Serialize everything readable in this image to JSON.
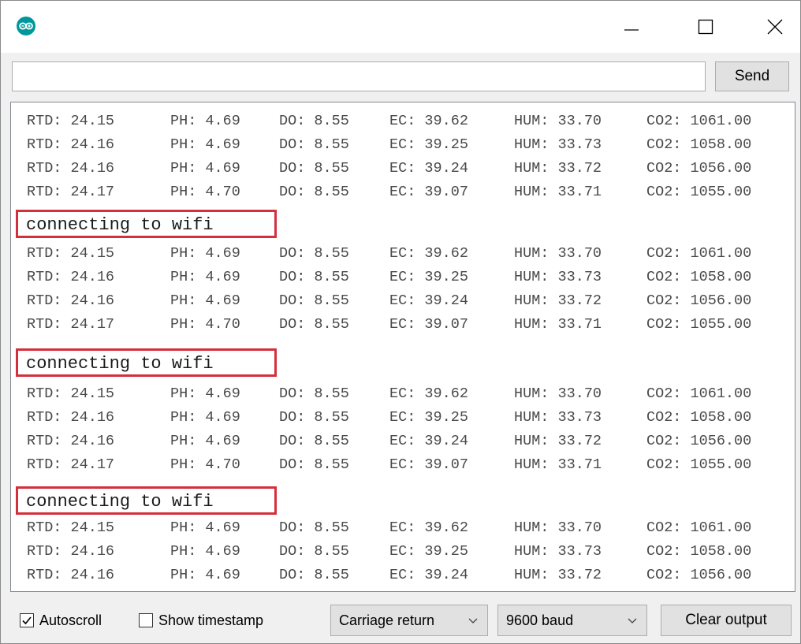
{
  "window": {
    "icon": "arduino-logo-icon",
    "accent_color": "#00979c",
    "highlight_color": "#d32f3c"
  },
  "toolbar": {
    "input_value": "",
    "send_label": "Send"
  },
  "output": {
    "readings": [
      [
        "RTD: 24.15",
        "PH: 4.69",
        "DO: 8.55",
        "EC: 39.62",
        "HUM: 33.70",
        "CO2: 1061.00"
      ],
      [
        "RTD: 24.16",
        "PH: 4.69",
        "DO: 8.55",
        "EC: 39.25",
        "HUM: 33.73",
        "CO2: 1058.00"
      ],
      [
        "RTD: 24.16",
        "PH: 4.69",
        "DO: 8.55",
        "EC: 39.24",
        "HUM: 33.72",
        "CO2: 1056.00"
      ],
      [
        "RTD: 24.17",
        "PH: 4.70",
        "DO: 8.55",
        "EC: 39.07",
        "HUM: 33.71",
        "CO2: 1055.00"
      ]
    ],
    "connect_message": "connecting to wifi"
  },
  "bottom": {
    "autoscroll_label": "Autoscroll",
    "autoscroll_checked": true,
    "timestamp_label": "Show timestamp",
    "timestamp_checked": false,
    "line_ending": "Carriage return",
    "baud": "9600 baud",
    "clear_label": "Clear output"
  }
}
